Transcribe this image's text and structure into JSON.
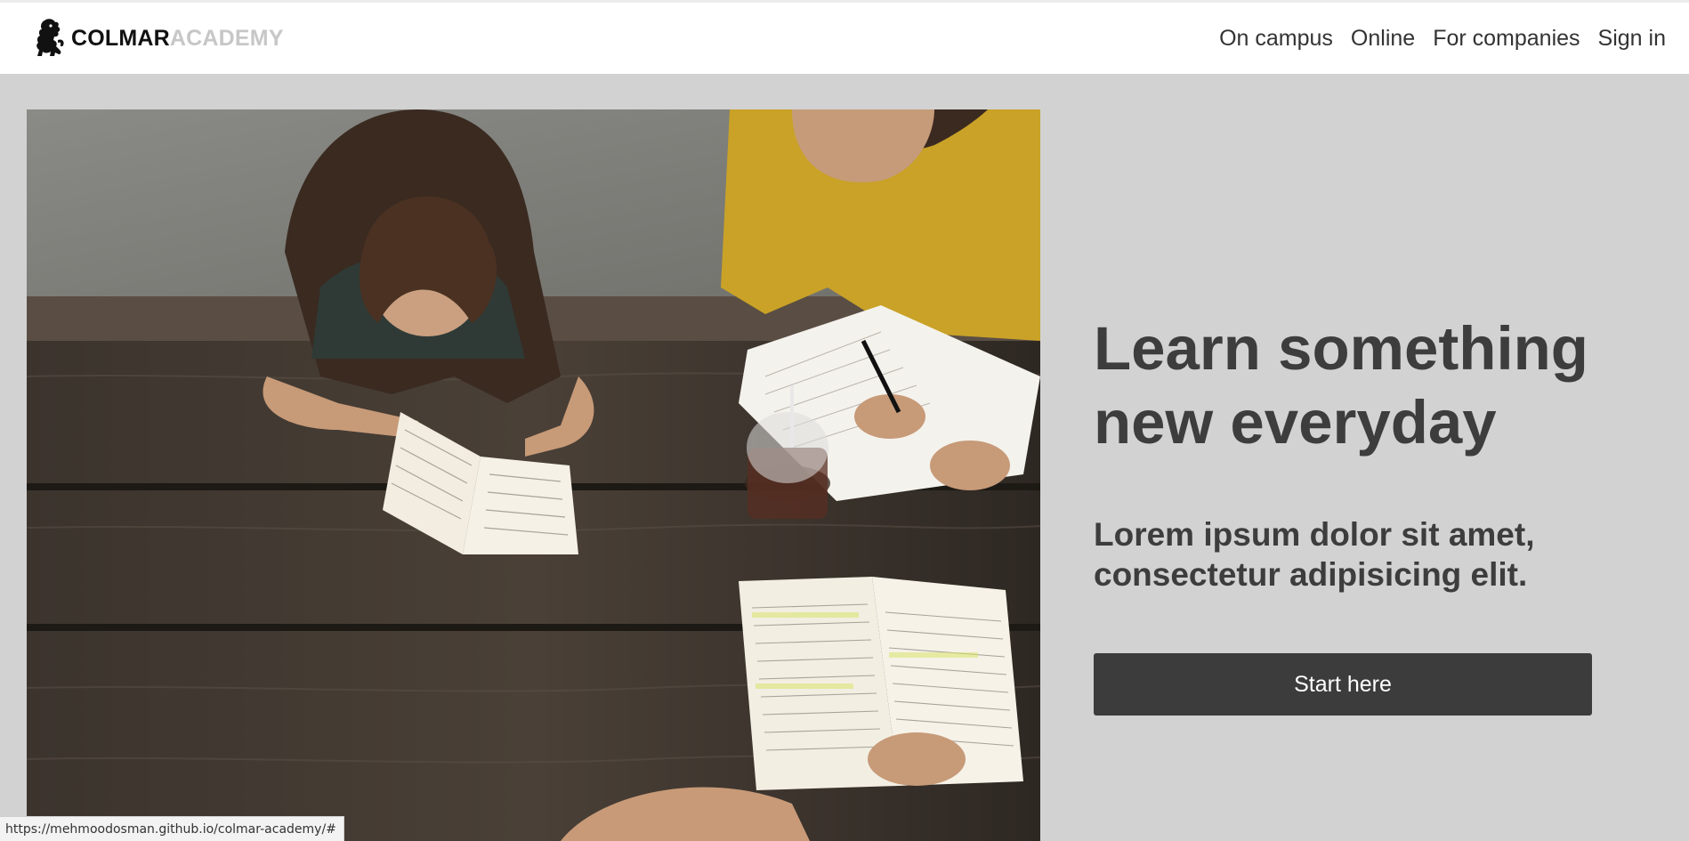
{
  "brand": {
    "word_dark": "COLMAR",
    "word_light": "ACADEMY",
    "logo_icon": "lion-crest-icon"
  },
  "nav": {
    "items": [
      {
        "label": "On campus"
      },
      {
        "label": "Online"
      },
      {
        "label": "For companies"
      },
      {
        "label": "Sign in"
      }
    ]
  },
  "hero": {
    "image_alt": "Students studying with books at a wooden picnic table",
    "title": "Learn something new everyday",
    "subtitle": "Lorem ipsum dolor sit amet, consectetur adipisicing elit.",
    "cta_label": "Start here"
  },
  "status_bar": {
    "url": "https://mehmoodosman.github.io/colmar-academy/#"
  },
  "colors": {
    "page_background": "#d2d2d2",
    "header_background": "#ffffff",
    "text_dark": "#3d3d3d",
    "brand_light": "#c7c7c7",
    "button_background": "#3c3c3c",
    "button_text": "#ffffff"
  }
}
